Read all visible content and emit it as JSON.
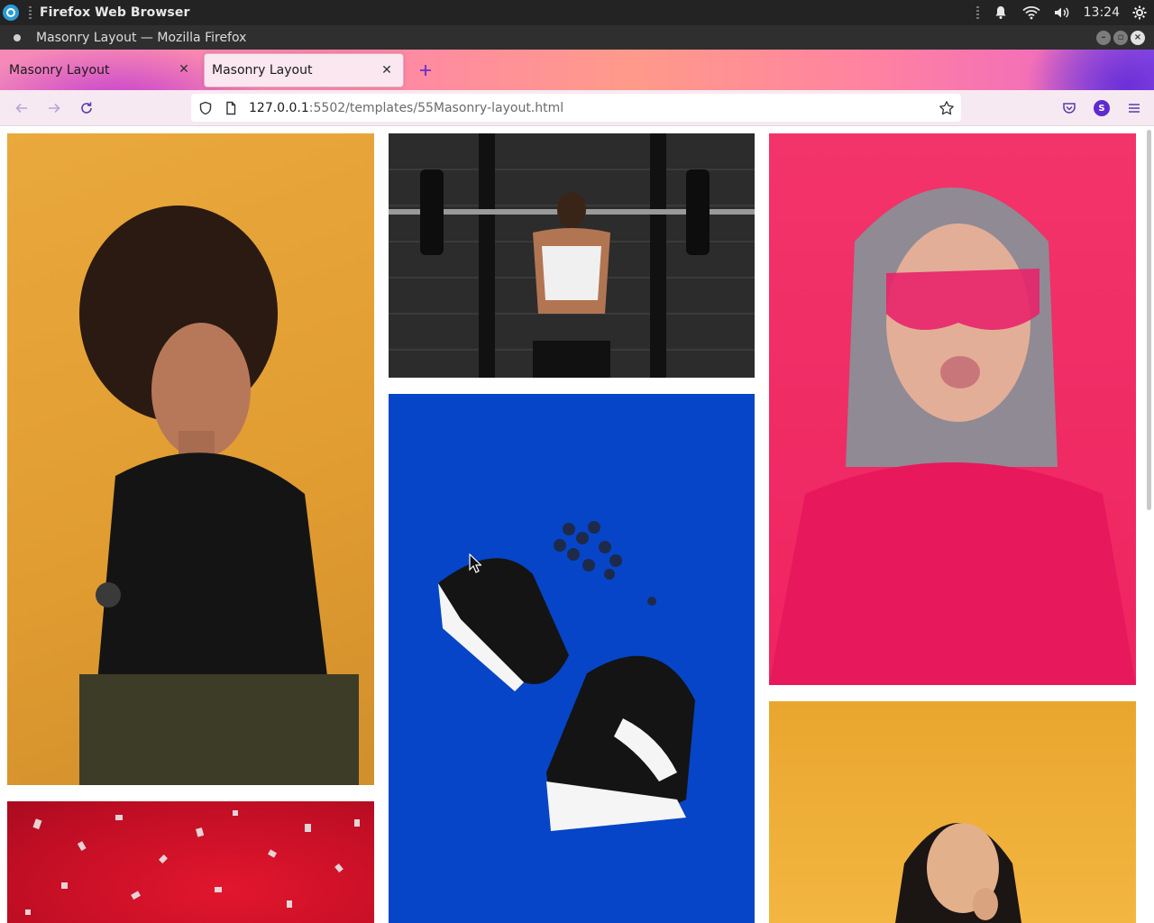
{
  "system_panel": {
    "app_name": "Firefox Web Browser",
    "clock": "13:24"
  },
  "window": {
    "title": "Masonry Layout — Mozilla Firefox"
  },
  "tabs": [
    {
      "label": "Masonry Layout",
      "active": false
    },
    {
      "label": "Masonry Layout",
      "active": true
    }
  ],
  "navbar": {
    "url_host": "127.0.0.1",
    "url_path": ":5502/templates/55Masonry-layout.html",
    "account_initial": "S"
  },
  "colors": {
    "accent": "#6a2bc8",
    "photo_orange": "#e5a53a",
    "photo_blue": "#0645c8",
    "photo_pink": "#f0245e",
    "photo_yellow": "#f2b23a",
    "photo_red": "#c8102e"
  },
  "gallery": [
    {
      "name": "woman-curly-hair-orange-photo"
    },
    {
      "name": "weightlifting-woman-photo"
    },
    {
      "name": "woman-pink-glasses-photo"
    },
    {
      "name": "sneakers-blueberries-photo"
    },
    {
      "name": "confetti-red-photo"
    },
    {
      "name": "smiling-woman-yellow-photo"
    }
  ]
}
